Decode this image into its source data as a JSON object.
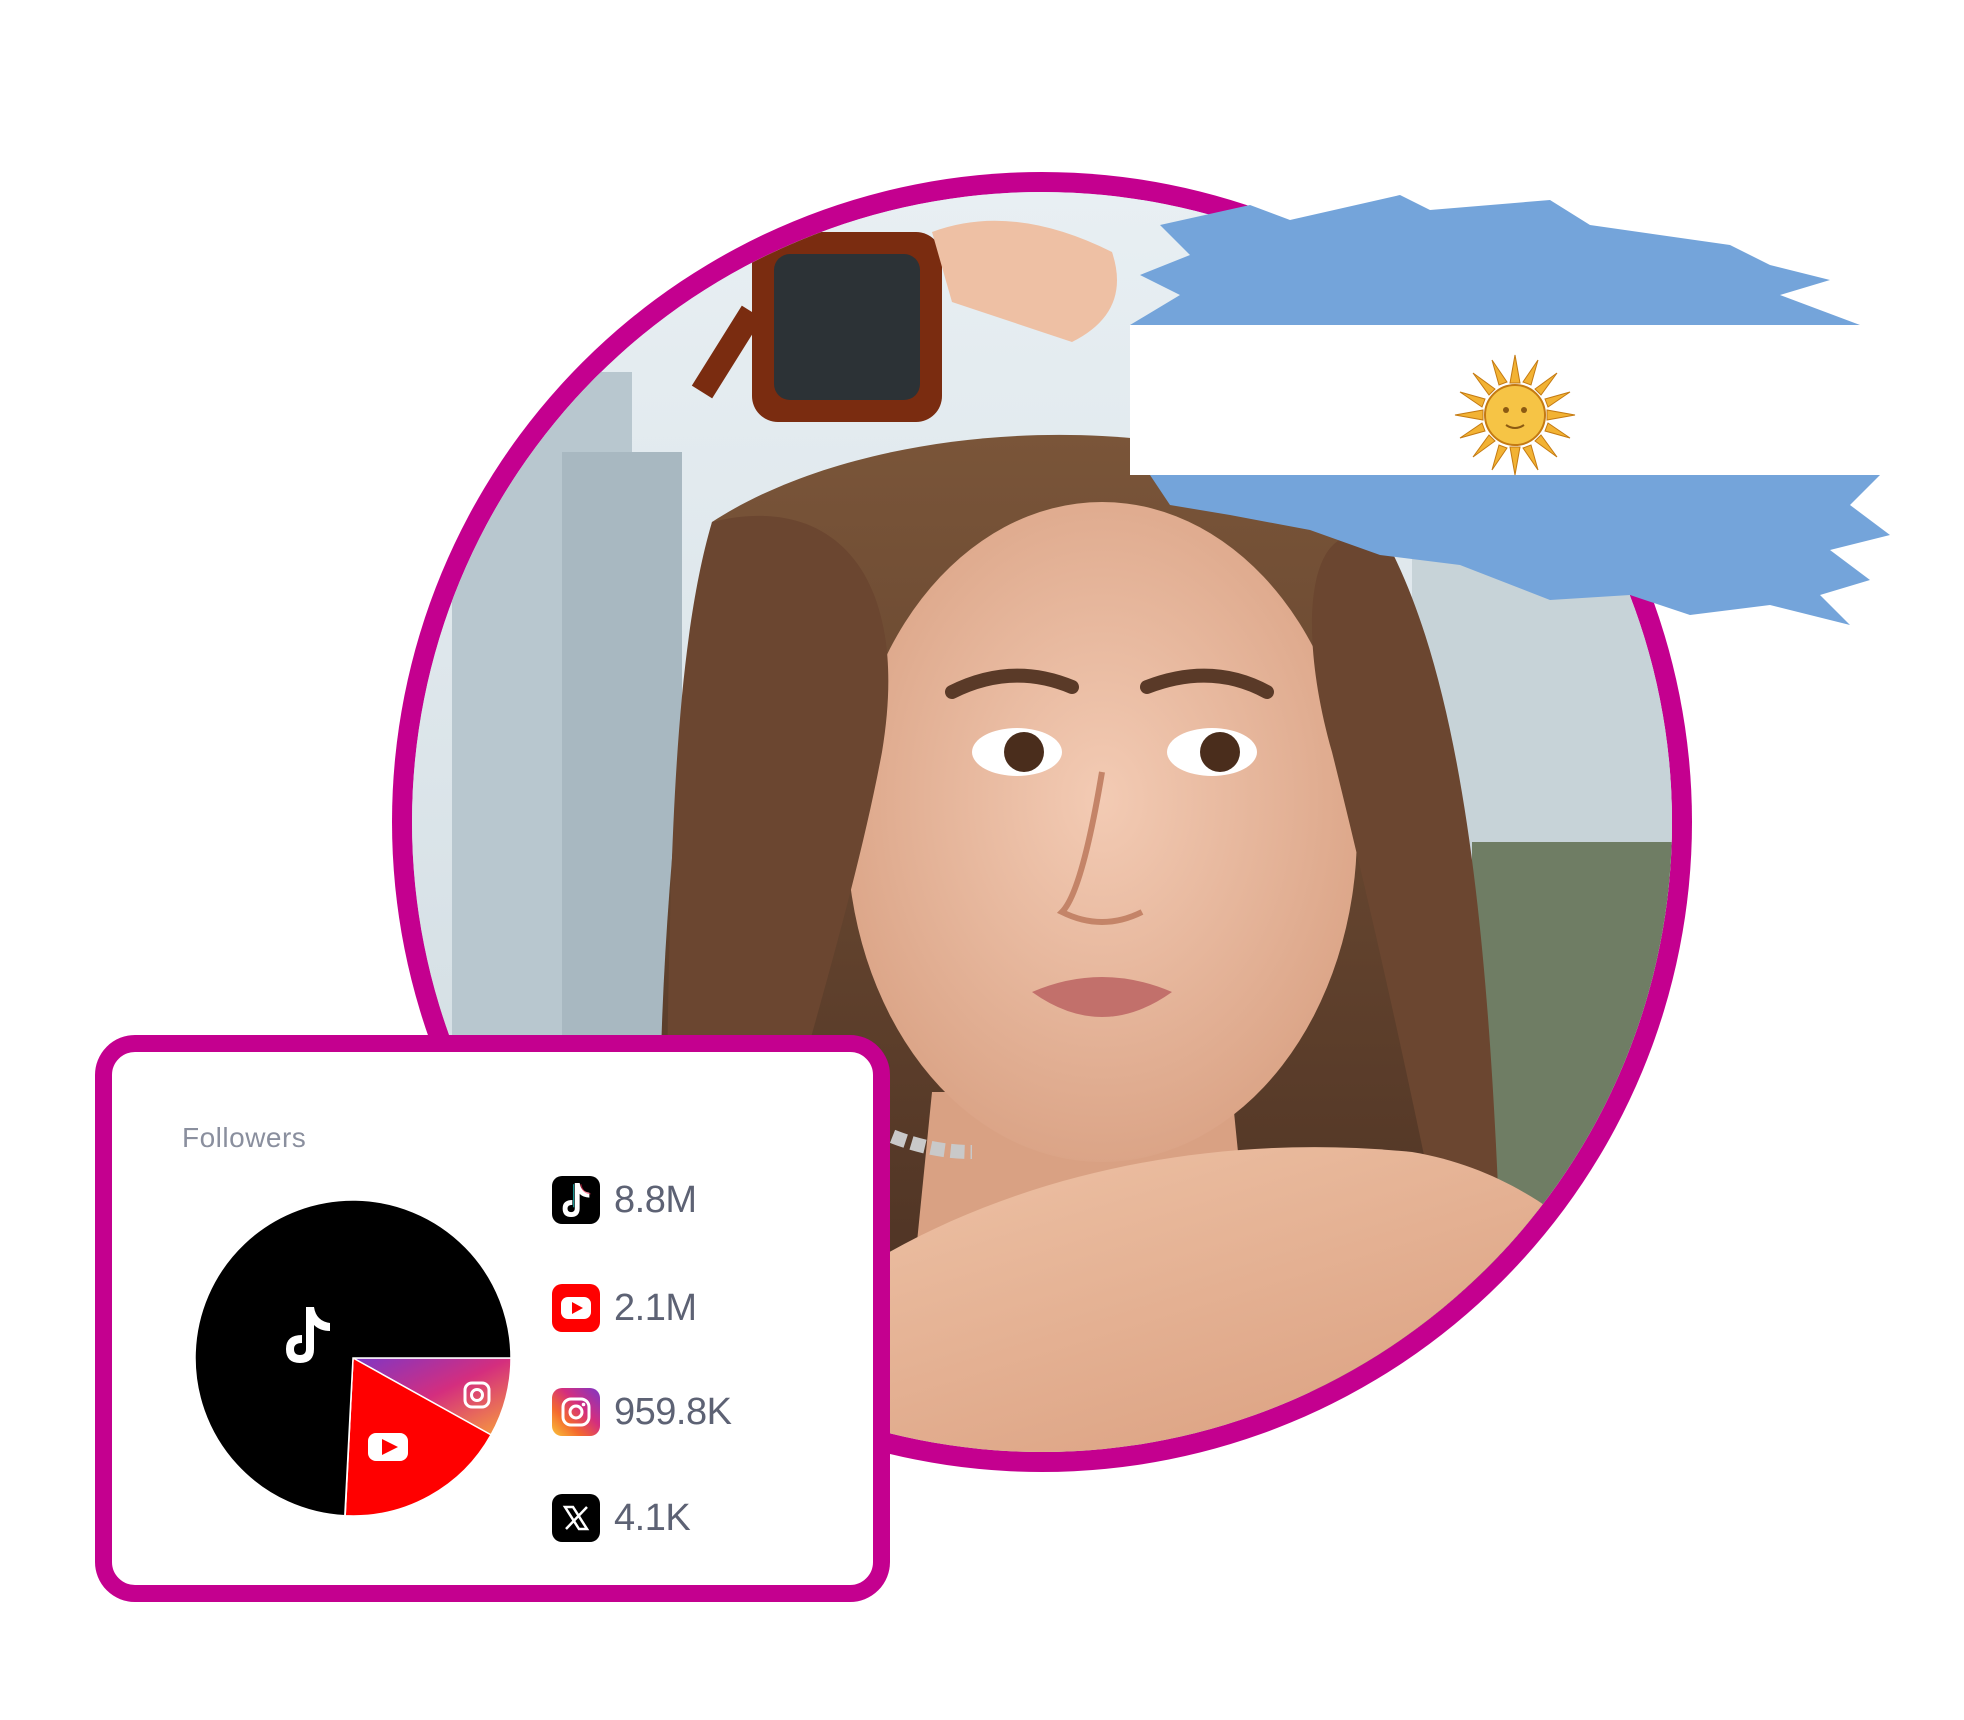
{
  "colors": {
    "accent_magenta": "#c4008f",
    "flag_blue": "#74a4da",
    "flag_white": "#ffffff",
    "sun_gold": "#f2b233",
    "tiktok": "#000000",
    "youtube": "#ff0000",
    "x": "#000000"
  },
  "profile": {
    "photo_alt_icon": "profile-photo",
    "country_flag_icon": "argentina-flag-icon"
  },
  "followers_card": {
    "title": "Followers",
    "platforms": [
      {
        "name_icon": "tiktok-icon",
        "value": "8.8M"
      },
      {
        "name_icon": "youtube-icon",
        "value": "2.1M"
      },
      {
        "name_icon": "instagram-icon",
        "value": "959.8K"
      },
      {
        "name_icon": "x-icon",
        "value": "4.1K"
      }
    ]
  },
  "chart_data": {
    "type": "pie",
    "title": "Followers",
    "categories": [
      "TikTok",
      "YouTube",
      "Instagram",
      "X"
    ],
    "values": [
      8.8,
      2.1,
      0.9598,
      0.0041
    ],
    "units": "millions"
  }
}
